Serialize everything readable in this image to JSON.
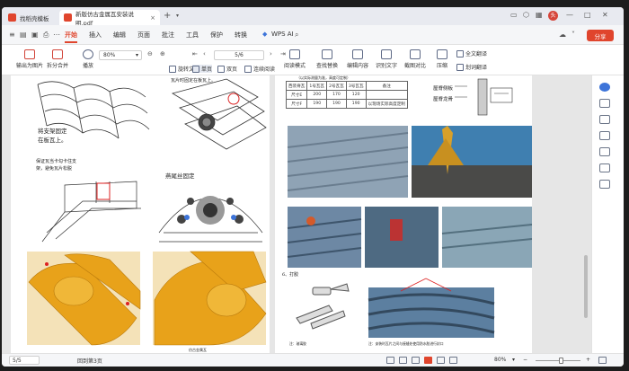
{
  "tabs": [
    {
      "label": "找稻壳模板",
      "color": "#e0452d"
    },
    {
      "label": "新版仿古金属瓦安装说明.pdf",
      "color": "#e0452d"
    }
  ],
  "menu": {
    "items": [
      "开始",
      "插入",
      "编辑",
      "页面",
      "批注",
      "工具",
      "保护",
      "转换"
    ],
    "wps_ai": "WPS AI",
    "share": "分享"
  },
  "toolbar": {
    "pdf_to_image": "输出为图片",
    "split_merge": "拆分合并",
    "play": "播放",
    "zoom": "80%",
    "page_input": "5/6",
    "rotate": "旋转文档",
    "single_page": "单页",
    "double_page": "双页",
    "continuous": "连续阅读",
    "reading_mode": "阅读模式",
    "find_replace": "查找替换",
    "edit_content": "编辑内容",
    "recognize_text": "识别文字",
    "screenshot_compare": "截图对比",
    "compress": "压缩",
    "full_translate": "全文翻译",
    "word_translate": "划词翻译"
  },
  "document": {
    "left_page": {
      "labels": [
        "瓦片时固定在板瓦上。",
        "将支架固定",
        "在板瓦上。",
        "保证瓦当卡勾卡住支",
        "架，避免瓦片松脱",
        "燕尾丝固定",
        "仿古金属瓦"
      ]
    },
    "right_page": {
      "table_caption": "（以实际测量为准，高度可定制）",
      "table": [
        [
          "西装脊瓦",
          "1号瓦瓦",
          "2号瓦瓦",
          "3号瓦瓦",
          "备注"
        ],
        [
          "尺寸E",
          "200",
          "170",
          "120",
          ""
        ],
        [
          "尺寸F",
          "190",
          "190",
          "190",
          "以现场实际高度定制"
        ]
      ],
      "label_a": "屋脊侧板",
      "label_b": "屋脊龙骨",
      "section_6": "6、打胶",
      "caption_1": "注：玻璃胶",
      "caption_2": "注：安装时瓦片之间与接缝处使用防水胶进行封口"
    }
  },
  "status": {
    "page": "5/5",
    "location": "回到第3页",
    "zoom": "80%"
  },
  "colors": {
    "accent": "#e0452d",
    "gold": "#e8a21a",
    "blue": "#3d74d9"
  }
}
